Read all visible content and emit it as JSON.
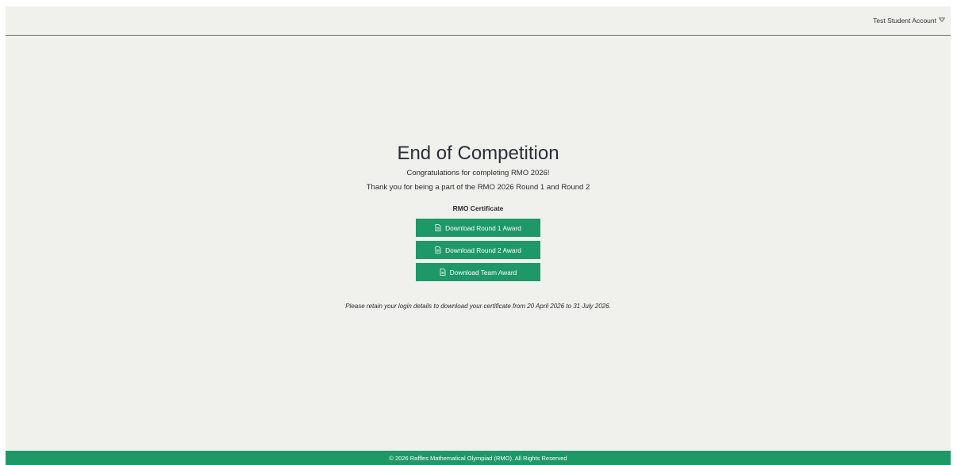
{
  "header": {
    "account_label": "Test Student Account",
    "account_icon": "chevron-down-icon"
  },
  "main": {
    "title": "End of Competition",
    "congrats": "Congratulations for completing RMO 2026!",
    "thanks": "Thank you for being a part of the RMO 2026 Round 1 and Round 2",
    "certificate_heading": "RMO Certificate",
    "buttons": [
      {
        "label": "Download Round 1 Award",
        "icon": "document-icon"
      },
      {
        "label": "Download Round 2 Award",
        "icon": "document-icon"
      },
      {
        "label": "Download Team Award",
        "icon": "document-icon"
      }
    ],
    "note": "Please retain your login details to download your certificate from 20 April 2026 to 31 July 2026."
  },
  "footer": {
    "text": "© 2026 Raffles Mathematical Olympiad (RMO). All Rights Reserved"
  },
  "colors": {
    "background": "#f0f0ec",
    "accent": "#1f9868",
    "text": "#2a2f3a"
  }
}
